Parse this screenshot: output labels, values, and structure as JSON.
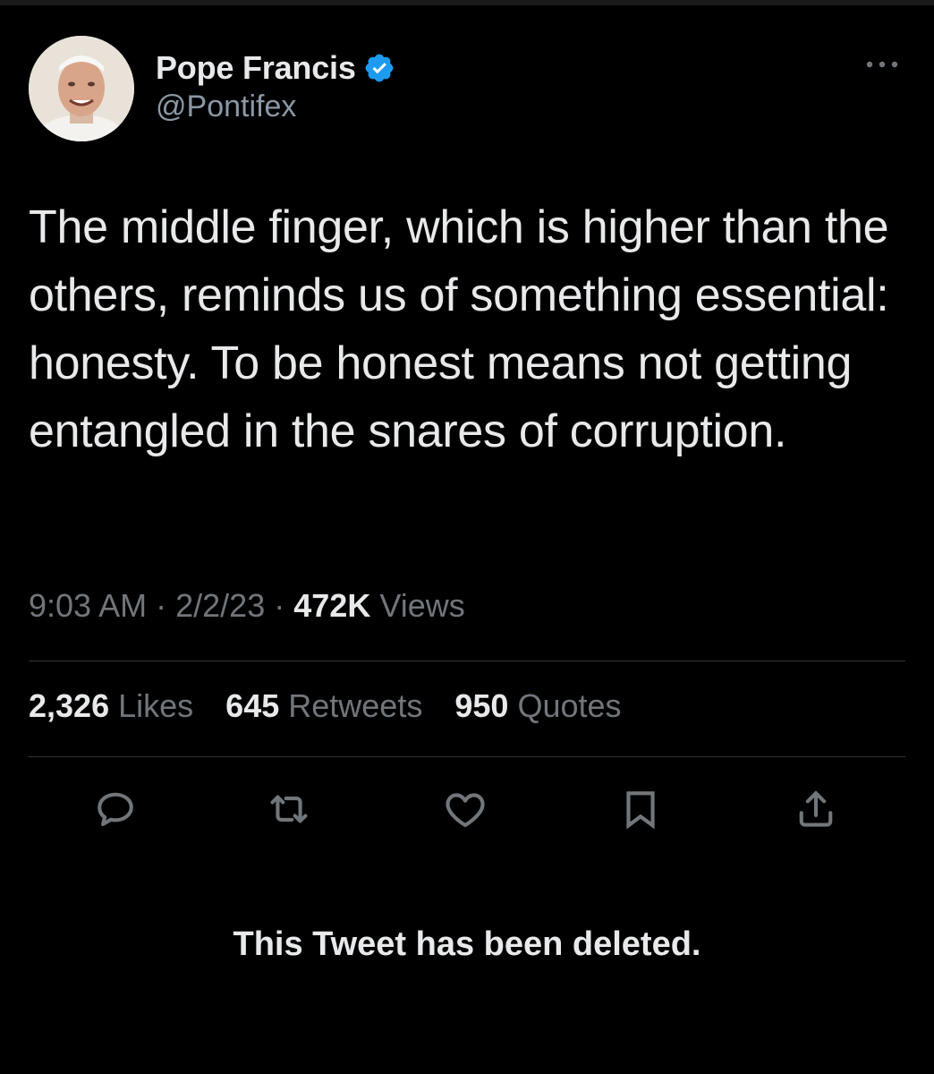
{
  "author": {
    "display_name": "Pope Francis",
    "handle": "@Pontifex",
    "verified": true,
    "avatar_icon": "pope-avatar"
  },
  "tweet": {
    "text": "The middle finger, which is higher than the others, reminds us of something essential: honesty. To be honest means not getting entangled in the snares of corruption.",
    "time": "9:03 AM",
    "date": "2/2/23",
    "views_count": "472K",
    "views_label": "Views",
    "separator": "·"
  },
  "stats": {
    "likes": {
      "count": "2,326",
      "label": "Likes"
    },
    "retweets": {
      "count": "645",
      "label": "Retweets"
    },
    "quotes": {
      "count": "950",
      "label": "Quotes"
    }
  },
  "actions": [
    "reply-icon",
    "retweet-icon",
    "like-icon",
    "bookmark-icon",
    "share-icon"
  ],
  "notice": "This Tweet has been deleted.",
  "colors": {
    "background": "#000000",
    "text": "#e7e9ea",
    "secondary": "#71767b",
    "verified": "#1d9bf0",
    "divider": "#2f3336"
  }
}
